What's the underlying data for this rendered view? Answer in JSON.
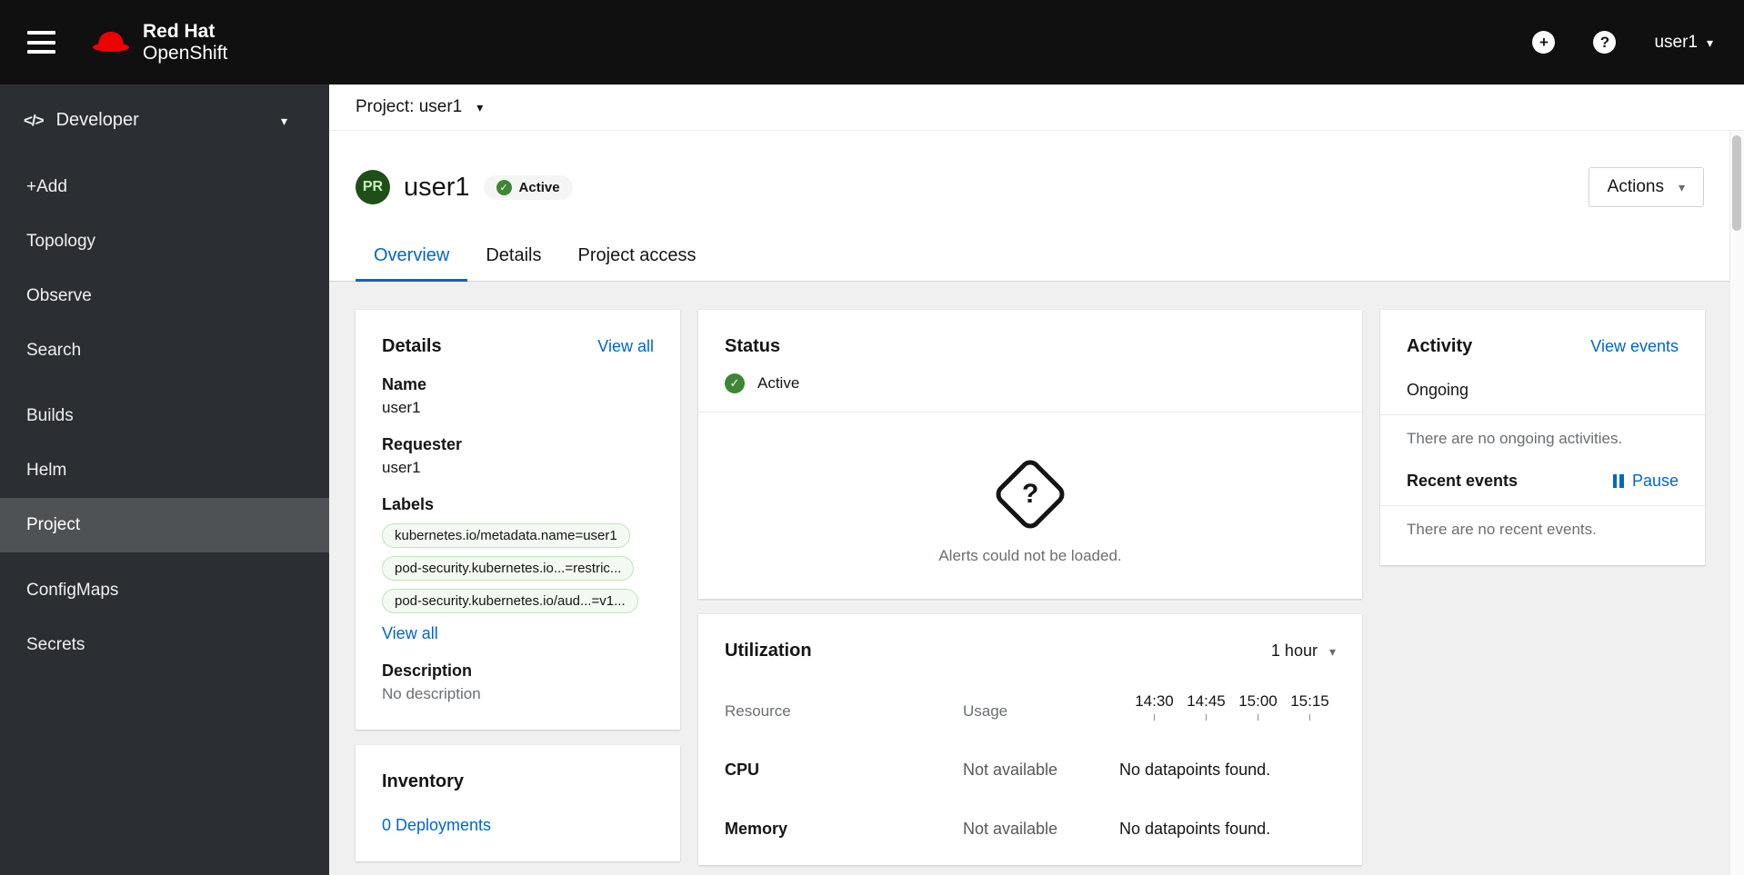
{
  "colors": {
    "brand_red": "#ee0000",
    "link_blue": "#0066cc",
    "success_green": "#3e8635",
    "masthead_bg": "#101010",
    "sidebar_bg": "#2b2e33",
    "content_bg": "#f0f0f0"
  },
  "icons": {
    "caret_down": "▾",
    "check": "✓",
    "plus": "+",
    "help": "?",
    "code": "</>",
    "unknown_mark": "?"
  },
  "masthead": {
    "brand_line1": "Red Hat",
    "brand_line2": "OpenShift",
    "user_menu": "user1"
  },
  "sidebar": {
    "perspective": "Developer",
    "sections": [
      {
        "items": [
          "+Add",
          "Topology",
          "Observe",
          "Search"
        ]
      },
      {
        "items": [
          "Builds",
          "Helm",
          "Project"
        ]
      },
      {
        "items": [
          "ConfigMaps",
          "Secrets"
        ]
      }
    ],
    "selected": "Project"
  },
  "project_bar": {
    "label": "Project: user1"
  },
  "page_header": {
    "badge": "PR",
    "title": "user1",
    "status": "Active",
    "actions": "Actions"
  },
  "tabs": [
    "Overview",
    "Details",
    "Project access"
  ],
  "details_card": {
    "title": "Details",
    "view_all": "View all",
    "name_label": "Name",
    "name_value": "user1",
    "requester_label": "Requester",
    "requester_value": "user1",
    "labels_label": "Labels",
    "labels": [
      "kubernetes.io/metadata.name=user1",
      "pod-security.kubernetes.io...=restric...",
      "pod-security.kubernetes.io/aud...=v1..."
    ],
    "labels_view_all": "View all",
    "description_label": "Description",
    "description_value": "No description"
  },
  "inventory_card": {
    "title": "Inventory",
    "deployments_link": "0 Deployments"
  },
  "status_card": {
    "title": "Status",
    "status": "Active",
    "alerts_message": "Alerts could not be loaded."
  },
  "utilization_card": {
    "title": "Utilization",
    "range": "1 hour",
    "col_resource": "Resource",
    "col_usage": "Usage",
    "times": [
      "14:30",
      "14:45",
      "15:00",
      "15:15"
    ],
    "rows": [
      {
        "name": "CPU",
        "usage": "Not available",
        "data": "No datapoints found."
      },
      {
        "name": "Memory",
        "usage": "Not available",
        "data": "No datapoints found."
      }
    ]
  },
  "activity_card": {
    "title": "Activity",
    "view_events": "View events",
    "ongoing_title": "Ongoing",
    "ongoing_empty": "There are no ongoing activities.",
    "recent_title": "Recent events",
    "pause": "Pause",
    "recent_empty": "There are no recent events."
  }
}
